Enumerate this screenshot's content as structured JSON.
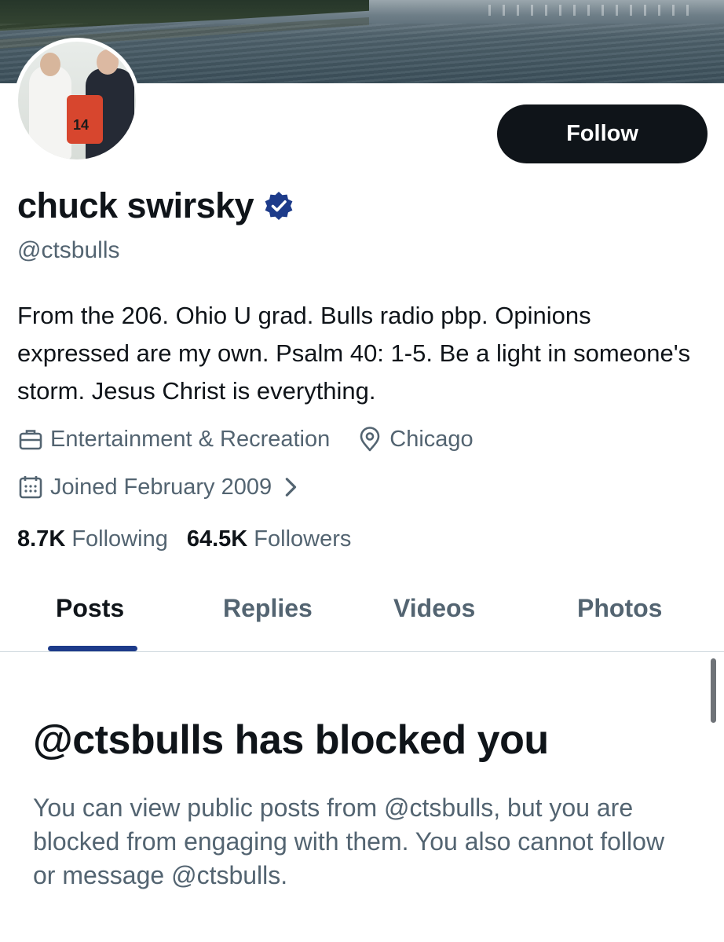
{
  "colors": {
    "primary_text": "#0f1419",
    "secondary_text": "#536471",
    "follow_button_bg": "#0f1419",
    "verified_badge": "#1d3b8a",
    "tab_indicator": "#1d3b8a",
    "divider": "#cfd9de"
  },
  "profile": {
    "display_name": "chuck swirsky",
    "verified": true,
    "handle": "@ctsbulls",
    "bio": "From the 206. Ohio U grad. Bulls radio pbp. Opinions expressed are my own. Psalm 40: 1-5. Be a light in someone's storm. Jesus Christ is everything.",
    "avatar_jersey_number": "14",
    "category": {
      "icon": "briefcase-icon",
      "label": "Entertainment & Recreation"
    },
    "location": {
      "icon": "location-pin-icon",
      "label": "Chicago"
    },
    "joined": {
      "icon": "calendar-icon",
      "label": "Joined February 2009"
    }
  },
  "actions": {
    "follow_label": "Follow"
  },
  "stats": {
    "following_count": "8.7K",
    "following_label": "Following",
    "followers_count": "64.5K",
    "followers_label": "Followers"
  },
  "tabs": [
    {
      "label": "Posts",
      "active": true
    },
    {
      "label": "Replies",
      "active": false
    },
    {
      "label": "Videos",
      "active": false
    },
    {
      "label": "Photos",
      "active": false
    }
  ],
  "blocked": {
    "title": "@ctsbulls has blocked you",
    "message": "You can view public posts from @ctsbulls, but you are blocked from engaging with them. You also cannot follow or message @ctsbulls."
  }
}
